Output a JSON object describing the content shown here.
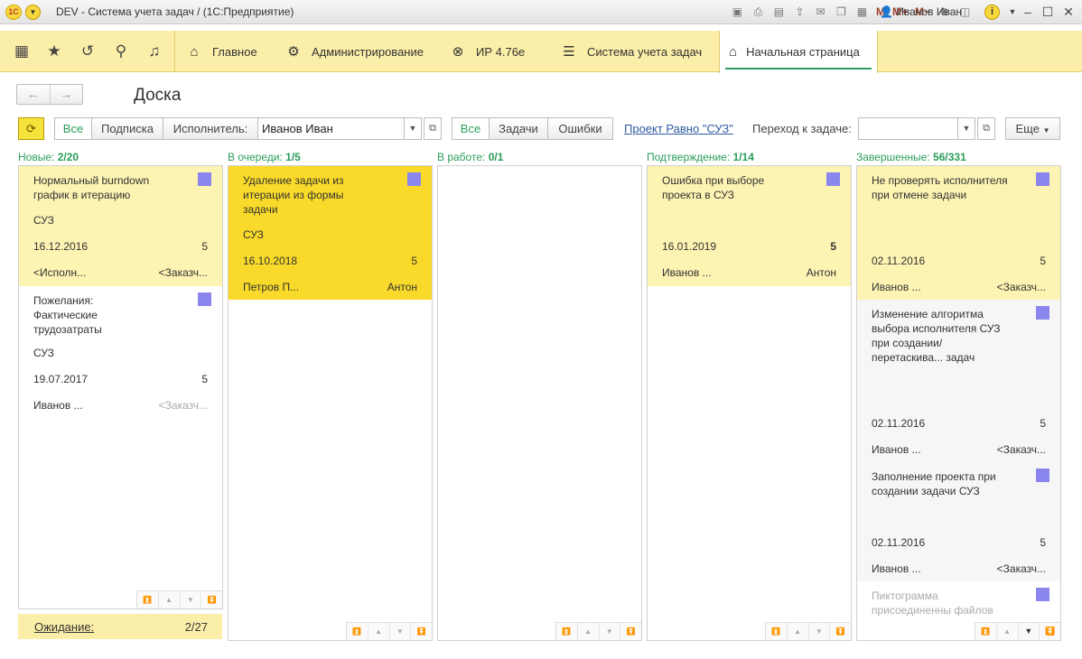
{
  "window": {
    "title": "DEV - Система учета задач /  (1С:Предприятие)",
    "logo_text": "1С",
    "user": "Иванов Иван",
    "toolbar_m": [
      "M",
      "M+",
      "M−"
    ]
  },
  "nav": {
    "sections": [
      {
        "label": "Главное",
        "icon": "home-icon"
      },
      {
        "label": "Администрирование",
        "icon": "gear-icon"
      },
      {
        "label": "ИР 4.76е",
        "icon": "tool-icon"
      },
      {
        "label": "Система учета задач",
        "icon": "list-icon"
      }
    ],
    "active_tab": "Начальная страница"
  },
  "page": {
    "title": "Доска",
    "back": "←",
    "forward": "→"
  },
  "filters": {
    "all_label": "Все",
    "subscription_label": "Подписка",
    "executor_label": "Исполнитель:",
    "executor_value": "Иванов Иван",
    "type_all_label": "Все",
    "tasks_label": "Задачи",
    "errors_label": "Ошибки",
    "project_link": "Проект Равно \"СУЗ\"",
    "goto_label": "Переход к задаче:",
    "goto_value": "",
    "more_label": "Еще"
  },
  "columns": [
    {
      "name": "Новые:",
      "count": "2/20"
    },
    {
      "name": "В очереди:",
      "count": "1/5"
    },
    {
      "name": "В работе:",
      "count": "0/1"
    },
    {
      "name": "Подтверждение:",
      "count": "1/14"
    },
    {
      "name": "Завершенные:",
      "count": "56/331"
    }
  ],
  "cards": {
    "new": [
      {
        "title": "Нормальный burndown график в итерацию",
        "project": "СУЗ",
        "date": "16.12.2016",
        "points": "5",
        "executor": "<Исполн...",
        "customer": "<Заказч..."
      },
      {
        "title": "Пожелания: Фактические трудозатраты",
        "project": "СУЗ",
        "date": "19.07.2017",
        "points": "5",
        "executor": "Иванов ...",
        "customer": "<Заказч..."
      }
    ],
    "queue": [
      {
        "title": "Удаление задачи из итерации из формы задачи",
        "project": "СУЗ",
        "date": "16.10.2018",
        "points": "5",
        "executor": "Петров П...",
        "customer": "Антон"
      }
    ],
    "confirm": [
      {
        "title": "Ошибка при выборе проекта в СУЗ",
        "project": "",
        "date": "16.01.2019",
        "points": "5",
        "executor": "Иванов ...",
        "customer": "Антон"
      }
    ],
    "done": [
      {
        "title": "Не проверять исполнителя при отмене задачи",
        "date": "02.11.2016",
        "points": "5",
        "executor": "Иванов ...",
        "customer": "<Заказч..."
      },
      {
        "title": "Изменение алгоритма выбора исполнителя СУЗ при создании/перетаскива... задач",
        "date": "02.11.2016",
        "points": "5",
        "executor": "Иванов ...",
        "customer": "<Заказч..."
      },
      {
        "title": "Заполнение проекта при создании задачи СУЗ",
        "date": "02.11.2016",
        "points": "5",
        "executor": "Иванов ...",
        "customer": "<Заказч..."
      },
      {
        "title": "Пиктограмма присоединенны файлов"
      }
    ]
  },
  "waiting": {
    "label": "Ожидание:",
    "count": "2/27"
  },
  "colors": {
    "accent_green": "#2a9e5a",
    "card_light": "#fdf3b3",
    "card_bright": "#f9da2a",
    "marker": "#8b86ee",
    "nav_band": "#fbeea8"
  }
}
